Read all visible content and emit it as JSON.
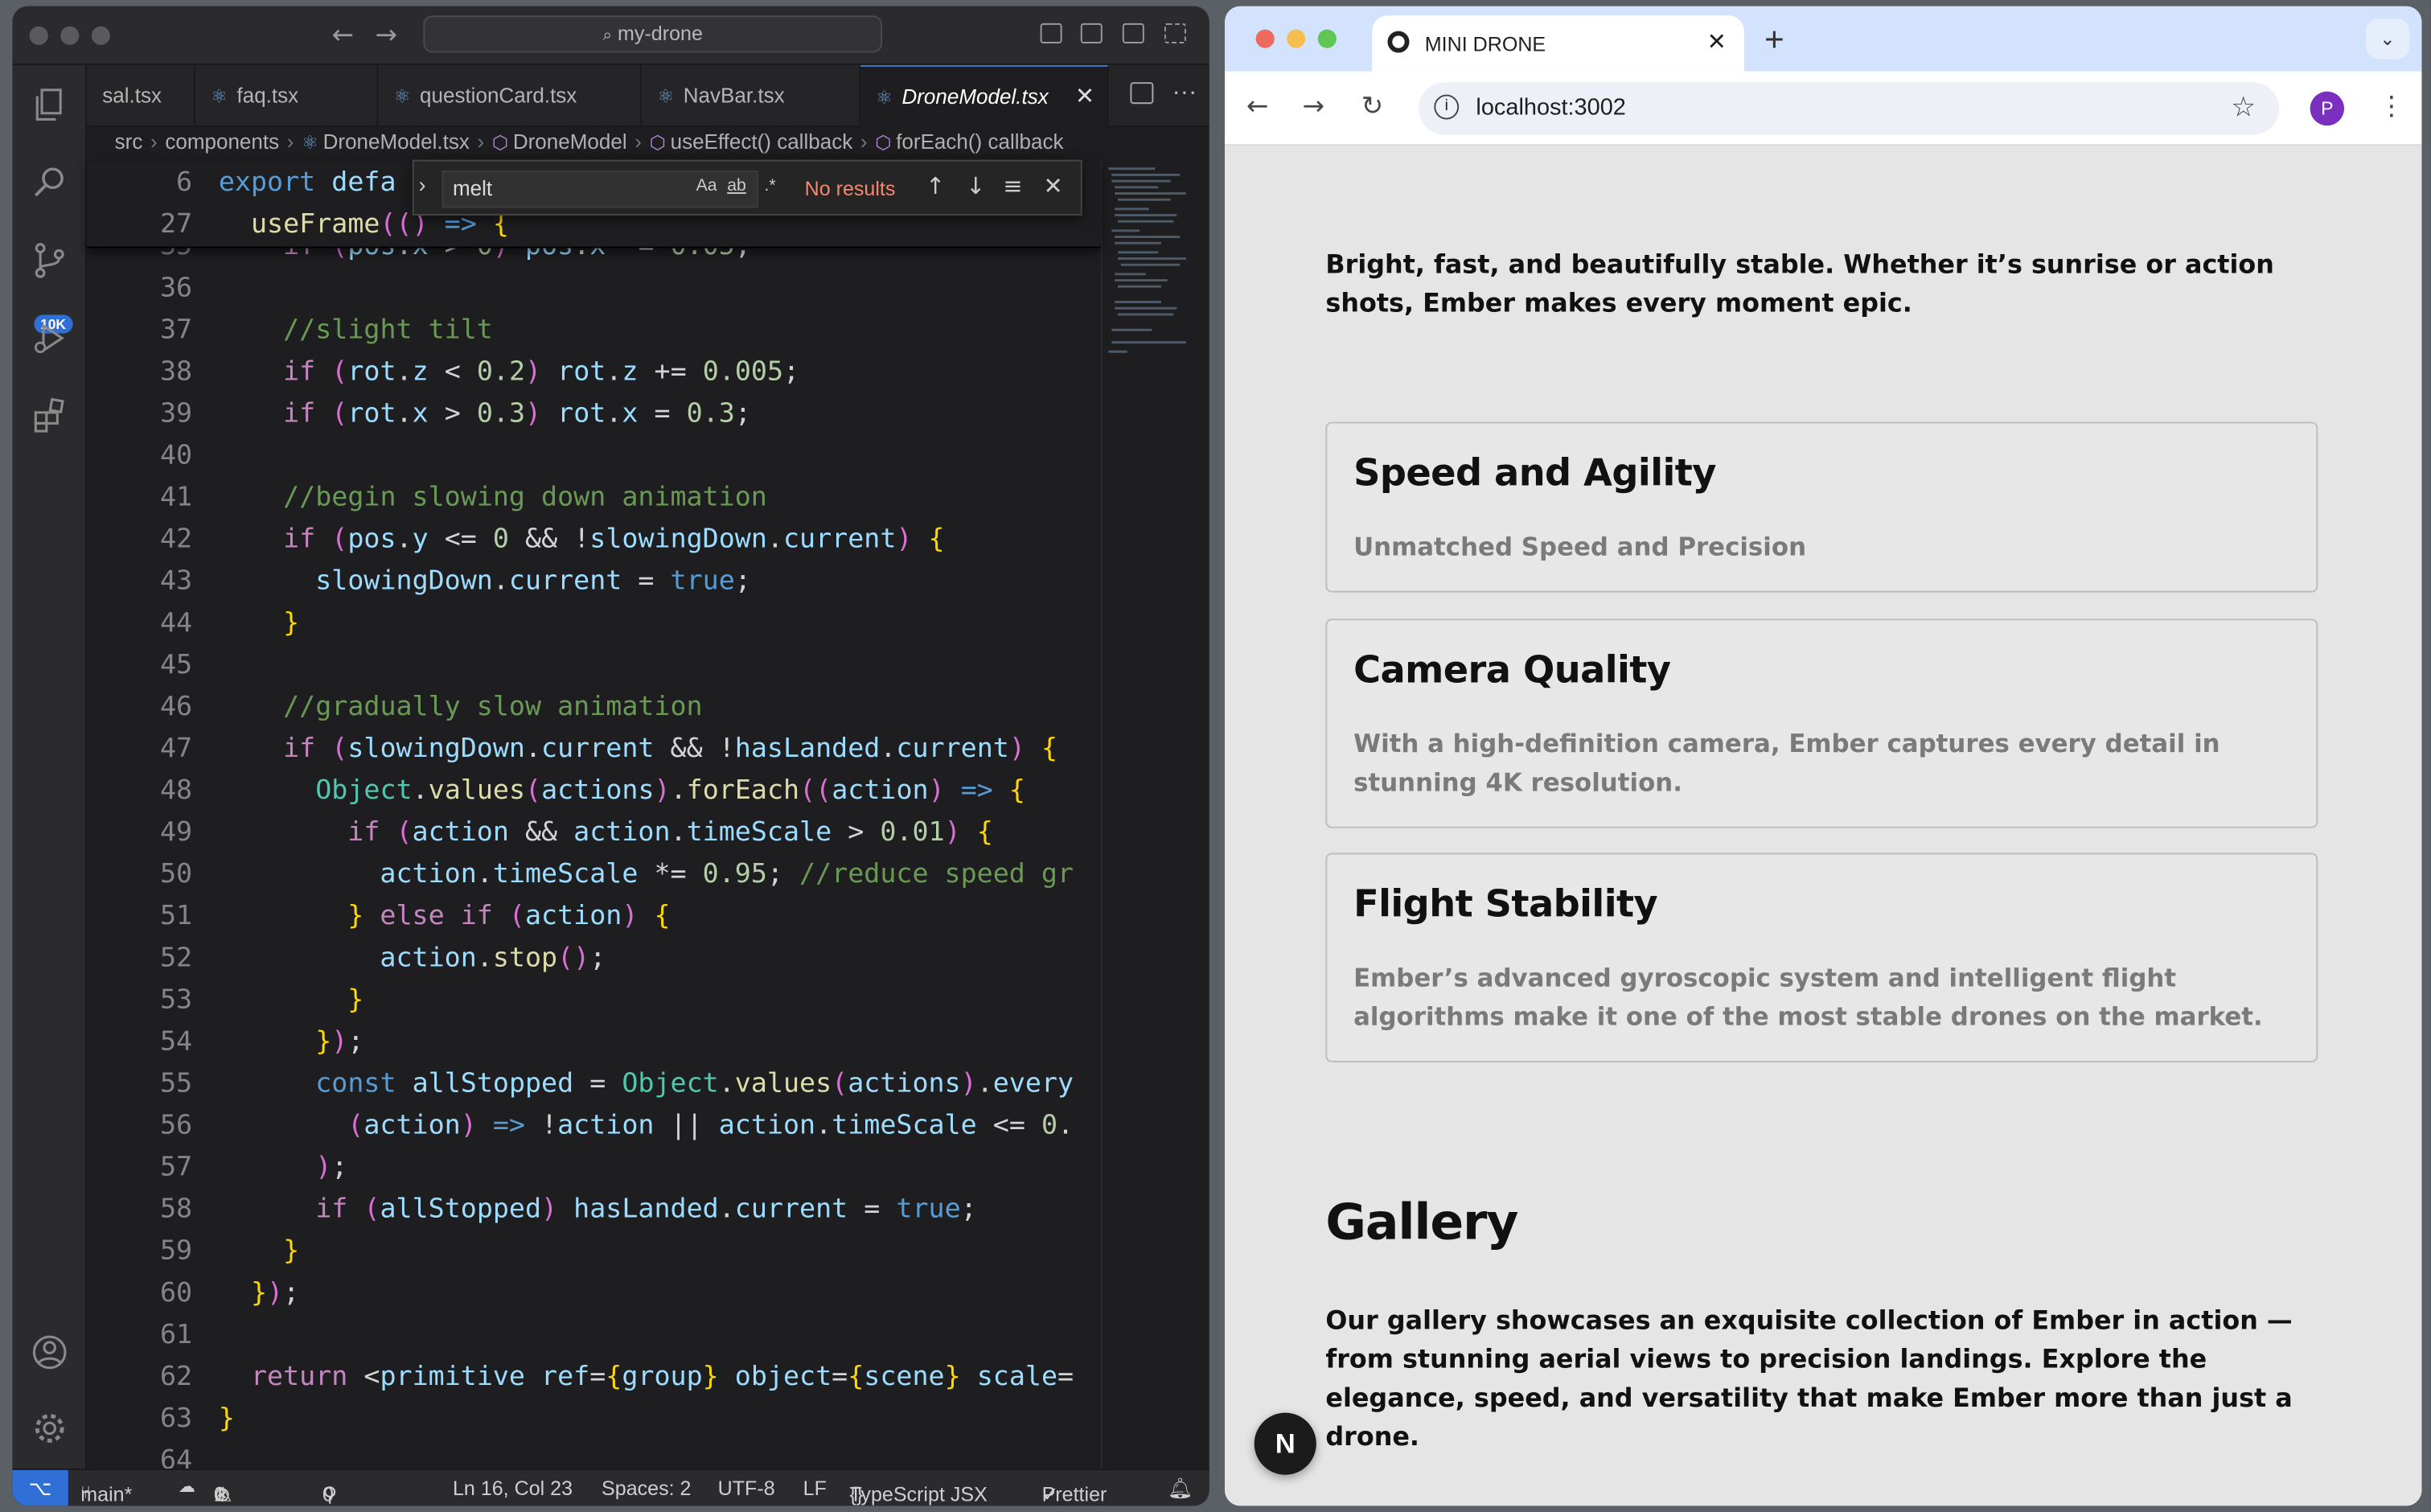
{
  "vscode": {
    "search": "my-drone",
    "tabs": [
      {
        "label": "sal.tsx"
      },
      {
        "label": "faq.tsx"
      },
      {
        "label": "questionCard.tsx"
      },
      {
        "label": "NavBar.tsx"
      },
      {
        "label": "DroneModel.tsx",
        "active": true
      }
    ],
    "breadcrumb": [
      "src",
      "components",
      "DroneModel.tsx",
      "DroneModel",
      "useEffect() callback",
      "forEach() callback"
    ],
    "scm_badge": "10K",
    "find": {
      "query": "melt",
      "case_label": "Aa",
      "word_label": "ab",
      "regex_label": ".*",
      "result": "No results"
    },
    "sticky": [
      {
        "n": "6",
        "text": "export defa"
      },
      {
        "n": "27",
        "text": "  useFrame(() => {"
      }
    ],
    "lines": [
      {
        "n": "35",
        "text": "    if (pos.x > 0) pos.x -= 0.05;"
      },
      {
        "n": "36",
        "text": ""
      },
      {
        "n": "37",
        "text": "    //slight tilt"
      },
      {
        "n": "38",
        "text": "    if (rot.z < 0.2) rot.z += 0.005;"
      },
      {
        "n": "39",
        "text": "    if (rot.x > 0.3) rot.x = 0.3;"
      },
      {
        "n": "40",
        "text": ""
      },
      {
        "n": "41",
        "text": "    //begin slowing down animation"
      },
      {
        "n": "42",
        "text": "    if (pos.y <= 0 && !slowingDown.current) {"
      },
      {
        "n": "43",
        "text": "      slowingDown.current = true;"
      },
      {
        "n": "44",
        "text": "    }"
      },
      {
        "n": "45",
        "text": ""
      },
      {
        "n": "46",
        "text": "    //gradually slow animation"
      },
      {
        "n": "47",
        "text": "    if (slowingDown.current && !hasLanded.current) {"
      },
      {
        "n": "48",
        "text": "      Object.values(actions).forEach((action) => {"
      },
      {
        "n": "49",
        "text": "        if (action && action.timeScale > 0.01) {"
      },
      {
        "n": "50",
        "text": "          action.timeScale *= 0.95; //reduce speed gr"
      },
      {
        "n": "51",
        "text": "        } else if (action) {"
      },
      {
        "n": "52",
        "text": "          action.stop();"
      },
      {
        "n": "53",
        "text": "        }"
      },
      {
        "n": "54",
        "text": "      });"
      },
      {
        "n": "55",
        "text": "      const allStopped = Object.values(actions).every"
      },
      {
        "n": "56",
        "text": "        (action) => !action || action.timeScale <= 0."
      },
      {
        "n": "57",
        "text": "      );"
      },
      {
        "n": "58",
        "text": "      if (allStopped) hasLanded.current = true;"
      },
      {
        "n": "59",
        "text": "    }"
      },
      {
        "n": "60",
        "text": "  });"
      },
      {
        "n": "61",
        "text": ""
      },
      {
        "n": "62",
        "text": "  return <primitive ref={group} object={scene} scale="
      },
      {
        "n": "63",
        "text": "}"
      },
      {
        "n": "64",
        "text": ""
      }
    ],
    "status": {
      "branch": "main*",
      "errors": "0",
      "warnings": "1",
      "ports": "0",
      "position": "Ln 16, Col 23",
      "spaces": "Spaces: 2",
      "encoding": "UTF-8",
      "eol": "LF",
      "language": "TypeScript JSX",
      "formatter": "Prettier"
    }
  },
  "chrome": {
    "tab_title": "MINI DRONE",
    "url": "localhost:3002",
    "profile": "P",
    "page": {
      "lead": "Bright, fast, and beautifully stable. Whether it’s sunrise or action shots, Ember makes every moment epic.",
      "cards": [
        {
          "title": "Speed and Agility",
          "text": "Unmatched Speed and Precision"
        },
        {
          "title": "Camera Quality",
          "text": "With a high-definition camera, Ember captures every detail in stunning 4K resolution."
        },
        {
          "title": "Flight Stability",
          "text": "Ember’s advanced gyroscopic system and intelligent flight algorithms make it one of the most stable drones on the market."
        }
      ],
      "gallery_title": "Gallery",
      "gallery_text": "Our gallery showcases an exquisite collection of Ember in action — from stunning aerial views to precision landings. Explore the elegance, speed, and versatility that make Ember more than just a drone.",
      "next_badge": "N"
    }
  }
}
